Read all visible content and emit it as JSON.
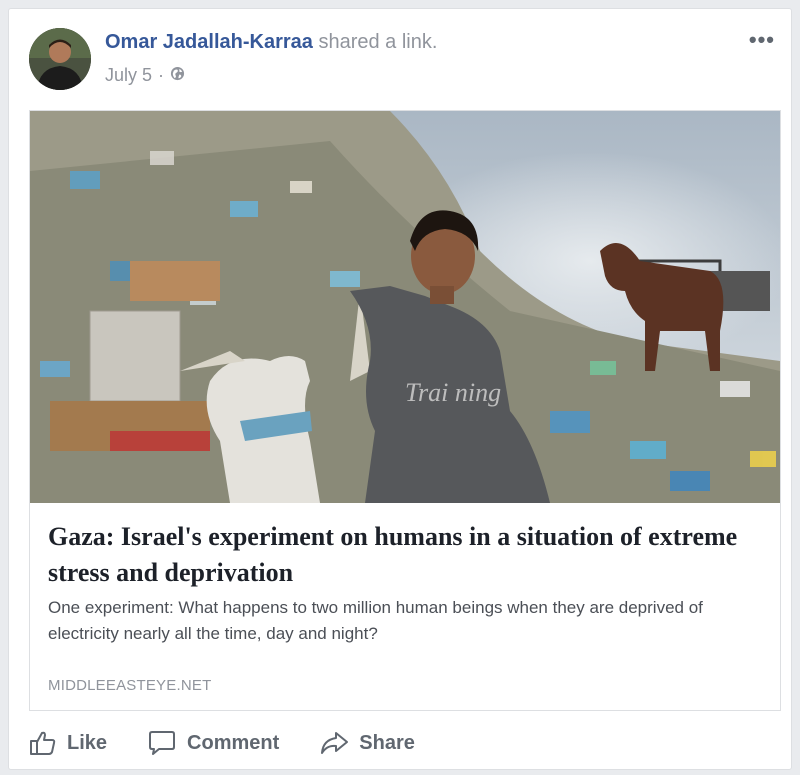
{
  "post": {
    "author": "Omar Jadallah-Karraa",
    "shared_text": "shared a",
    "shared_link": "link.",
    "date": "July 5",
    "separator": "·",
    "privacy_icon": "globe-icon",
    "more_label": "•••"
  },
  "link": {
    "headline": "Gaza: Israel's experiment on humans in a situation of extreme stress and deprivation",
    "description": "One experiment: What happens to two million human beings when they are deprived of electricity nearly all the time, day and night?",
    "domain": "MIDDLEEASTEYE.NET"
  },
  "actions": {
    "like": "Like",
    "comment": "Comment",
    "share": "Share"
  },
  "colors": {
    "author_link": "#365899",
    "meta": "#90949c",
    "action": "#606770"
  }
}
